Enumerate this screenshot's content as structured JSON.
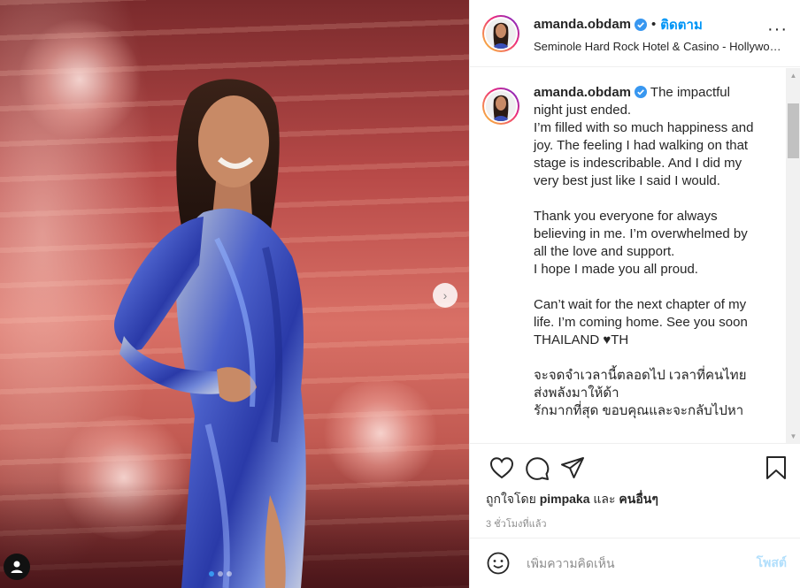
{
  "post": {
    "username": "amanda.obdam",
    "bullet": "•",
    "follow_label": "ติดตาม",
    "location": "Seminole Hard Rock Hotel & Casino - Hollywood, Florida",
    "more_icon": "ellipsis-icon",
    "more_label": "···"
  },
  "caption": {
    "username": "amanda.obdam",
    "text": " The impactful night just ended.\nI’m filled with so much happiness and joy. The feeling I had walking on that stage is indescribable. And I did my very best just like I said I would.\n\nThank you everyone for always believing in me. I’m overwhelmed by all the love and support.\nI hope I made you all proud.\n\nCan’t wait for the next chapter of my life. I’m coming home. See you soon THAILAND ♥TH\n\nจะจดจำเวลานี้ตลอดไป เวลาที่คนไทยส่งพลังมาให้ด้า\nรักมากที่สุด ขอบคุณและจะกลับไปหา"
  },
  "actions": {
    "like_icon": "heart-icon",
    "comment_icon": "comment-icon",
    "share_icon": "share-icon",
    "save_icon": "bookmark-icon"
  },
  "likes": {
    "prefix": "ถูกใจโดย",
    "user": "pimpaka",
    "and": "และ",
    "others": "คนอื่นๆ"
  },
  "timestamp": "3 ชั่วโมงที่แล้ว",
  "comment_box": {
    "placeholder": "เพิ่มความคิดเห็น",
    "post_label": "โพสต์",
    "emoji_icon": "smiley-icon"
  },
  "media": {
    "next_label": "›",
    "carousel_count": 3,
    "carousel_active": 1
  },
  "colors": {
    "accent": "#0095f6",
    "verified": "#3897f0",
    "post_disabled": "#b2dffc",
    "muted": "#8e8e8e"
  }
}
